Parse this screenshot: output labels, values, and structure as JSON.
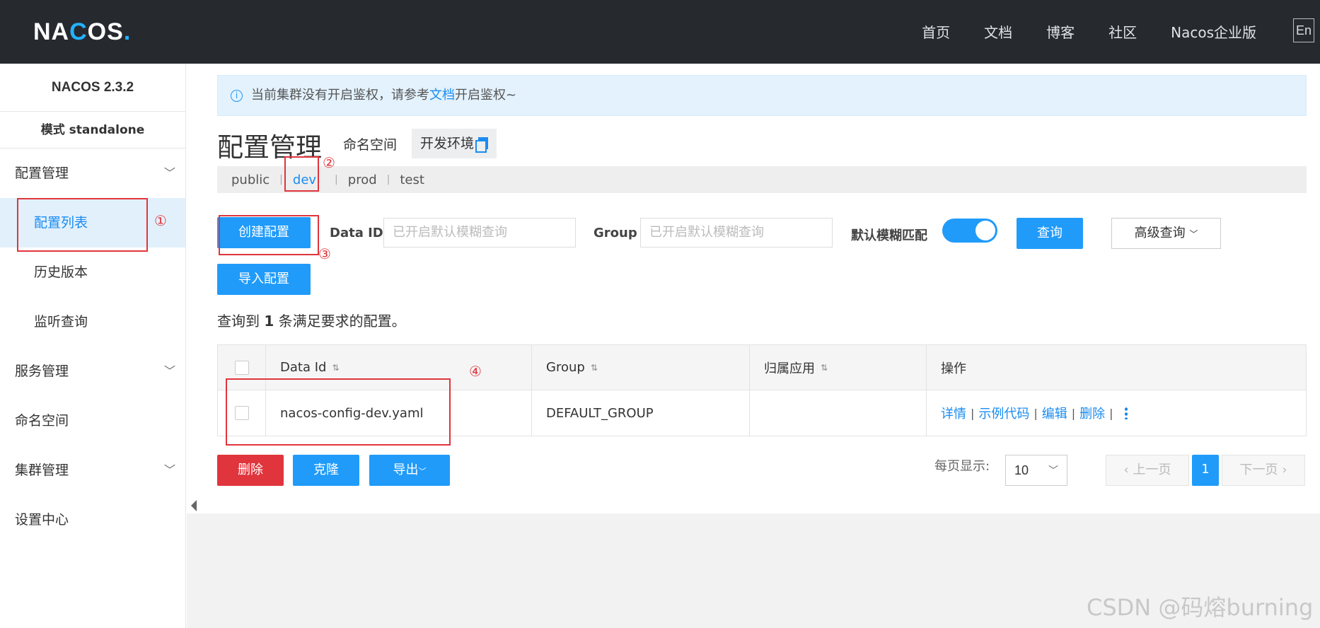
{
  "header": {
    "logo_prefix": "NA",
    "logo_o": "C",
    "logo_mid": "O",
    "logo_suffix": "S",
    "logo_dot": ".",
    "nav": [
      "首页",
      "文档",
      "博客",
      "社区",
      "Nacos企业版"
    ],
    "lang": "En"
  },
  "sidebar": {
    "version": "NACOS 2.3.2",
    "mode": "模式 standalone",
    "groups": [
      {
        "label": "配置管理",
        "items": [
          "配置列表",
          "历史版本",
          "监听查询"
        ]
      },
      {
        "label": "服务管理"
      },
      {
        "label": "命名空间"
      },
      {
        "label": "集群管理"
      },
      {
        "label": "设置中心"
      }
    ]
  },
  "annotations": [
    "①",
    "②",
    "③",
    "④"
  ],
  "notice": {
    "before": "当前集群没有开启鉴权，请参考",
    "link": "文档",
    "after": "开启鉴权~"
  },
  "page": {
    "title": "配置管理",
    "namespace_label": "命名空间",
    "namespace_value": "开发环境",
    "tabs": [
      "public",
      "dev",
      "prod",
      "test"
    ],
    "active_tab": "dev"
  },
  "toolbar": {
    "create": "创建配置",
    "data_id_label": "Data ID",
    "data_id_placeholder": "已开启默认模糊查询",
    "group_label": "Group",
    "group_placeholder": "已开启默认模糊查询",
    "fuzzy_label": "默认模糊匹配",
    "query": "查询",
    "advanced": "高级查询",
    "import": "导入配置"
  },
  "result": {
    "prefix": "查询到",
    "count": "1",
    "suffix": "条满足要求的配置。"
  },
  "table": {
    "headers": [
      "Data Id",
      "Group",
      "归属应用",
      "操作"
    ],
    "rows": [
      {
        "data_id": "nacos-config-dev.yaml",
        "group": "DEFAULT_GROUP",
        "app": ""
      }
    ],
    "ops": [
      "详情",
      "示例代码",
      "编辑",
      "删除"
    ]
  },
  "bottom": {
    "delete": "删除",
    "clone": "克隆",
    "export": "导出",
    "page_size_label": "每页显示:",
    "page_size": "10",
    "prev": "上一页",
    "current_page": "1",
    "next": "下一页"
  },
  "watermark": "CSDN @码熔burning",
  "colors": {
    "primary": "#209bfa",
    "danger": "#e0353c",
    "annotation": "#e0353c",
    "topbar": "#262a2f"
  }
}
